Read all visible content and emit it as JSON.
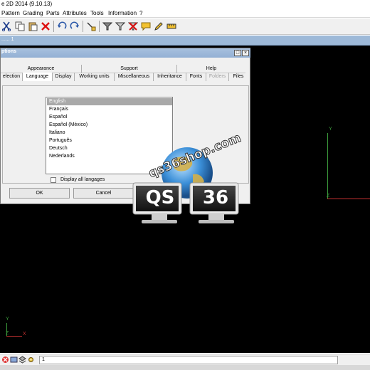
{
  "window": {
    "title": "e 2D 2014 (9.10.13)"
  },
  "menu": [
    "Pattern",
    "Grading",
    "Parts",
    "Attributes",
    "Tools",
    "Information",
    "?"
  ],
  "toolbar": {
    "icons": [
      "cut-icon",
      "copy-icon",
      "paste-icon",
      "delete-icon",
      "undo-icon",
      "redo-icon",
      "pick-icon",
      "filter-icon",
      "filter-alt-icon",
      "filter-clear-icon",
      "comment-icon",
      "edit-icon",
      "measure-icon"
    ]
  },
  "document_tab": {
    "label": "...... 1"
  },
  "dialog": {
    "title": "ptions",
    "upper_tabs": [
      "Appearance",
      "Support",
      "Help"
    ],
    "lower_tabs": [
      "election",
      "Language",
      "Display",
      "Working units",
      "Miscellaneous",
      "Inheritance",
      "Fonts",
      "Folders",
      "Files"
    ],
    "disabled_tab": "Folders",
    "active_tab": "Language",
    "languages": [
      "English",
      "Français",
      "Español",
      "Español (México)",
      "Italiano",
      "Português",
      "Deutsch",
      "Nederlands"
    ],
    "selected_language": "English",
    "checkbox_label": "Display all langages",
    "ok_label": "OK",
    "cancel_label": "Cancel"
  },
  "axes": {
    "left": {
      "y": "Y",
      "z": "Z",
      "x": "X"
    },
    "right": {
      "y": "Y",
      "z": "Z"
    }
  },
  "watermark": {
    "site": "qs36shop.com",
    "left_screen": "QS",
    "right_screen": "36"
  },
  "statusbar": {
    "value": "1"
  },
  "colors": {
    "canvas": "#000000",
    "axis_y": "#3c9b3c",
    "axis_x": "#c83232",
    "selection": "#a9a9a9"
  }
}
